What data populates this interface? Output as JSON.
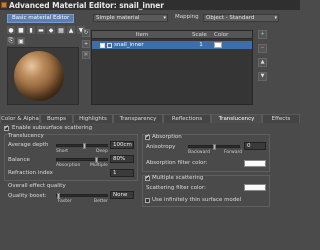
{
  "window": {
    "title": "Advanced Material Editor: snail_inner"
  },
  "preview": {
    "tabs": [
      "Basic material Editor"
    ],
    "toolbar_icons": [
      "sphere-icon",
      "cube-icon",
      "cylinder-icon",
      "plane-icon",
      "material-icon",
      "checker-icon",
      "load-icon",
      "save-icon",
      "copy-icon",
      "lock-icon"
    ]
  },
  "material_type": {
    "value": "Simple material"
  },
  "mapping": {
    "label": "Mapping",
    "value": "Object - Standard"
  },
  "list": {
    "headers": [
      "Item",
      "Scale",
      "Color"
    ],
    "rows": [
      {
        "name": "snail_inner",
        "scale": "1"
      }
    ]
  },
  "tabs": [
    "Color & Alpha",
    "Bumps",
    "Highlights",
    "Transparency",
    "Reflections",
    "Translucency",
    "Effects"
  ],
  "active_tab": "Translucency",
  "translucency": {
    "enable_label": "Enable subsurface scattering",
    "section_label": "Translucency",
    "depth": {
      "label": "Average depth",
      "value": "100cm",
      "left": "Short",
      "right": "Deep",
      "level": 0.55
    },
    "balance": {
      "label": "Balance",
      "value": "80%",
      "left": "Absorption",
      "right": "Multiple",
      "level": 0.8
    },
    "refraction": {
      "label": "Refraction index",
      "value": "1"
    },
    "quality": {
      "section_label": "Overall effect quality",
      "label": "Quality boost:",
      "left": "Faster",
      "right": "Better",
      "value": "None",
      "level": 0.0
    }
  },
  "absorption": {
    "label": "Absorption",
    "anisotropy": {
      "label": "Anisotropy",
      "value": "0",
      "left": "Backward",
      "right": "Forward",
      "level": 0.5
    },
    "filter_label": "Absorption filter color:",
    "filter_color": "#fafafa"
  },
  "scattering": {
    "label": "Multiple scattering",
    "filter_label": "Scattering filter color:",
    "filter_color": "#fafafa",
    "thin_label": "Use infinitely thin surface model"
  },
  "colors": {
    "accent": "#3d6ea8",
    "background": "#4a4a4a"
  }
}
